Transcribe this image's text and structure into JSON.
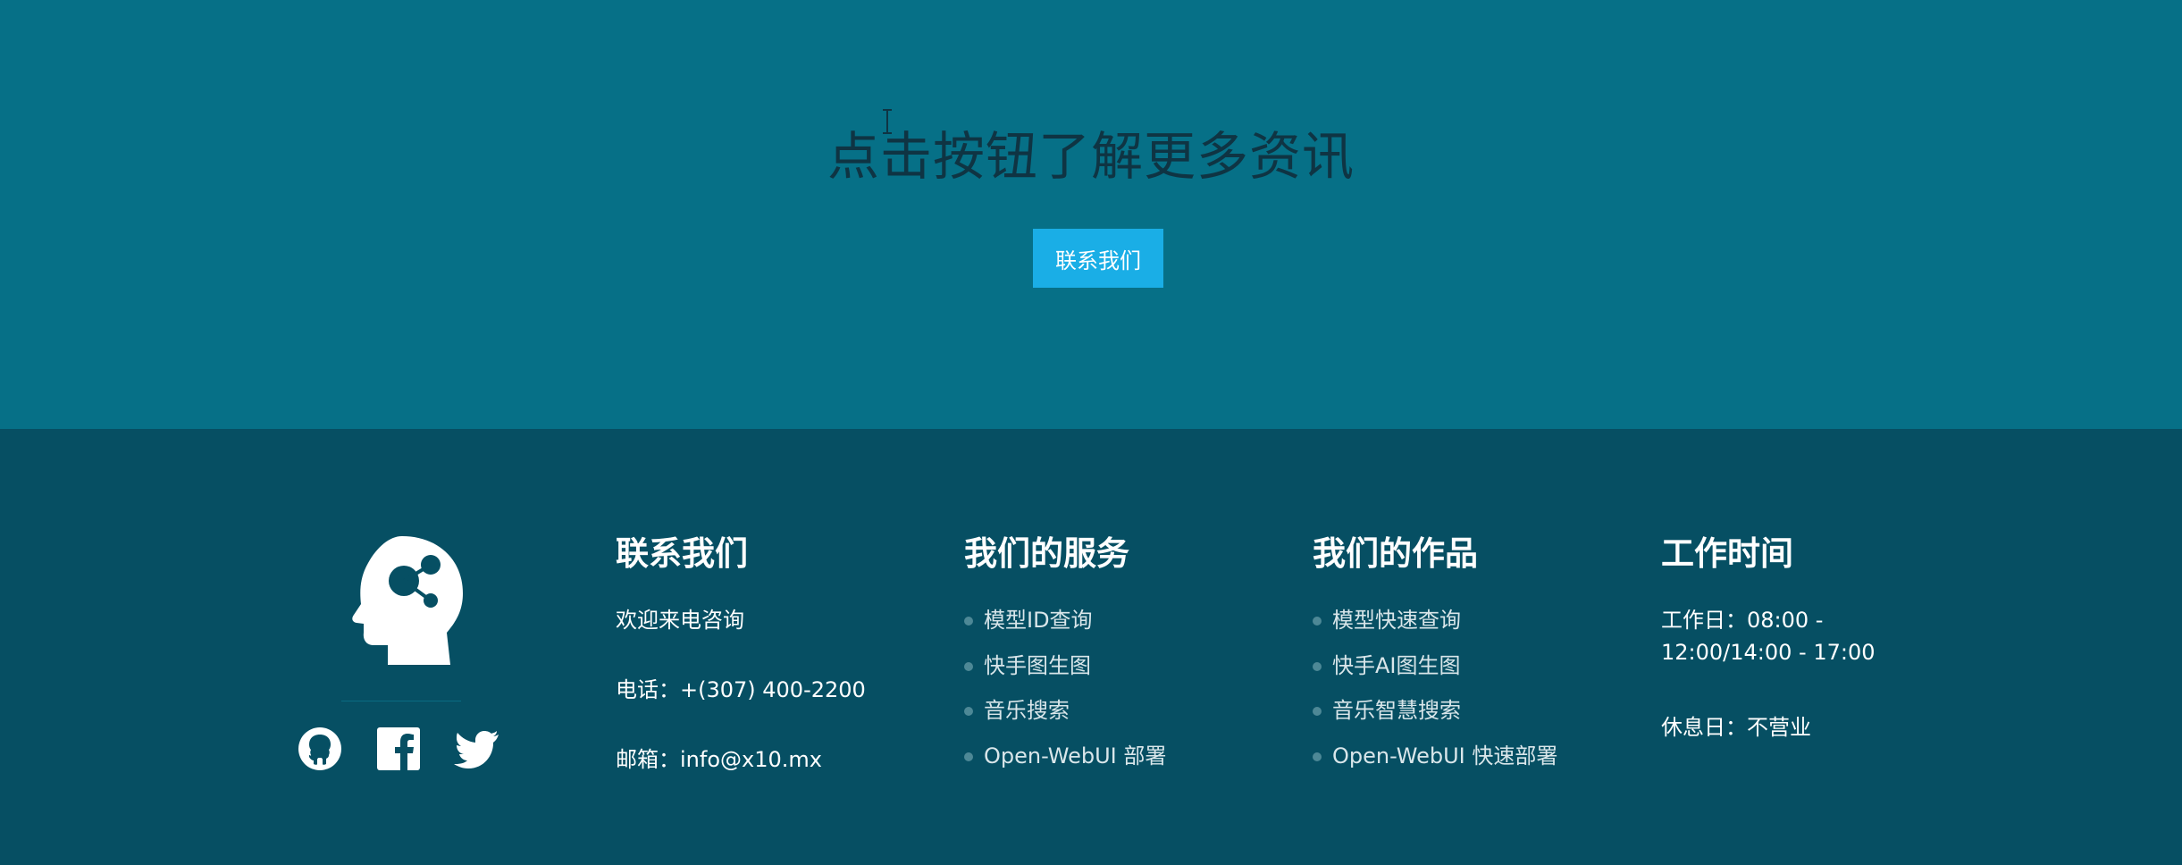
{
  "cta": {
    "title": "点击按钮了解更多资讯",
    "button_label": "联系我们"
  },
  "brand": {
    "logo_icon": "head-network-icon",
    "social": [
      {
        "name": "github-icon"
      },
      {
        "name": "facebook-icon"
      },
      {
        "name": "twitter-icon"
      }
    ]
  },
  "contact": {
    "heading": "联系我们",
    "welcome": "欢迎来电咨询",
    "phone": "电话：+(307) 400-2200",
    "email": "邮箱：info@x10.mx"
  },
  "services": {
    "heading": "我们的服务",
    "items": [
      "模型ID查询",
      "快手图生图",
      "音乐搜索",
      "Open-WebUI 部署"
    ]
  },
  "works": {
    "heading": "我们的作品",
    "items": [
      "模型快速查询",
      "快手AI图生图",
      "音乐智慧搜索",
      "Open-WebUI 快速部署"
    ]
  },
  "hours": {
    "heading": "工作时间",
    "weekday_line1": "工作日：08:00 -",
    "weekday_line2": "12:00/14:00 - 17:00",
    "weekend": "休息日：不营业"
  },
  "colors": {
    "cta_bg": "#067087",
    "footer_bg": "#064f63",
    "button": "#1aaee6"
  }
}
